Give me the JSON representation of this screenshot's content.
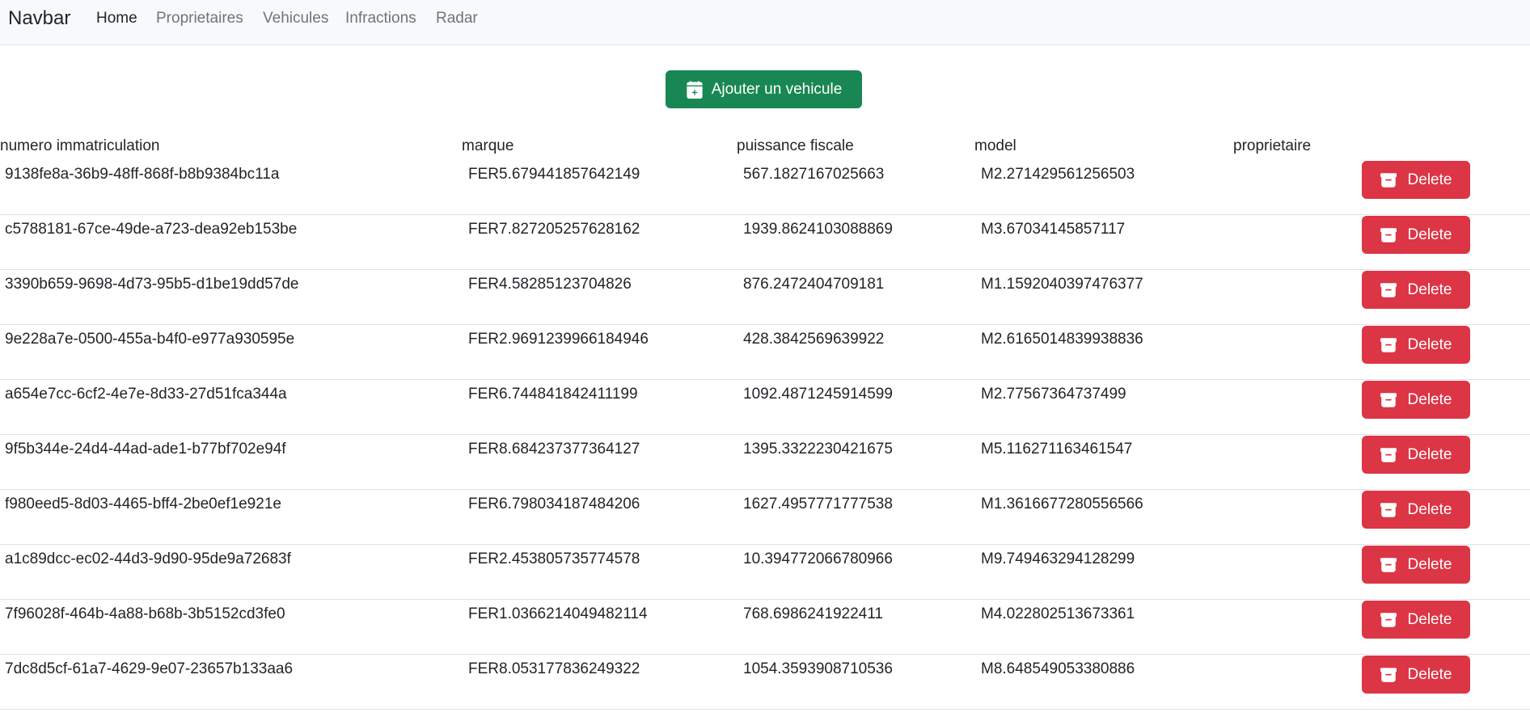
{
  "navbar": {
    "brand": "Navbar",
    "links": [
      {
        "label": "Home",
        "active": true
      },
      {
        "label": "Proprietaires",
        "active": false
      },
      {
        "label": "Vehicules",
        "active": false
      },
      {
        "label": "Infractions",
        "active": false
      },
      {
        "label": "Radar",
        "active": false
      }
    ]
  },
  "add_button": {
    "label": "Ajouter un vehicule",
    "icon": "calendar-plus-icon"
  },
  "table": {
    "headers": [
      "numero immatriculation",
      "marque",
      "puissance fiscale",
      "model",
      "proprietaire"
    ],
    "delete_label": "Delete",
    "delete_icon": "archive-icon",
    "rows": [
      {
        "immatriculation": "9138fe8a-36b9-48ff-868f-b8b9384bc11a",
        "marque": "FER5.679441857642149",
        "puissance": "567.1827167025663",
        "model": "M2.271429561256503",
        "proprietaire": ""
      },
      {
        "immatriculation": "c5788181-67ce-49de-a723-dea92eb153be",
        "marque": "FER7.827205257628162",
        "puissance": "1939.8624103088869",
        "model": "M3.67034145857117",
        "proprietaire": ""
      },
      {
        "immatriculation": "3390b659-9698-4d73-95b5-d1be19dd57de",
        "marque": "FER4.58285123704826",
        "puissance": "876.2472404709181",
        "model": "M1.1592040397476377",
        "proprietaire": ""
      },
      {
        "immatriculation": "9e228a7e-0500-455a-b4f0-e977a930595e",
        "marque": "FER2.9691239966184946",
        "puissance": "428.3842569639922",
        "model": "M2.6165014839938836",
        "proprietaire": ""
      },
      {
        "immatriculation": "a654e7cc-6cf2-4e7e-8d33-27d51fca344a",
        "marque": "FER6.744841842411199",
        "puissance": "1092.4871245914599",
        "model": "M2.77567364737499",
        "proprietaire": ""
      },
      {
        "immatriculation": "9f5b344e-24d4-44ad-ade1-b77bf702e94f",
        "marque": "FER8.684237377364127",
        "puissance": "1395.3322230421675",
        "model": "M5.116271163461547",
        "proprietaire": ""
      },
      {
        "immatriculation": "f980eed5-8d03-4465-bff4-2be0ef1e921e",
        "marque": "FER6.798034187484206",
        "puissance": "1627.4957771777538",
        "model": "M1.3616677280556566",
        "proprietaire": ""
      },
      {
        "immatriculation": "a1c89dcc-ec02-44d3-9d90-95de9a72683f",
        "marque": "FER2.453805735774578",
        "puissance": "10.394772066780966",
        "model": "M9.749463294128299",
        "proprietaire": ""
      },
      {
        "immatriculation": "7f96028f-464b-4a88-b68b-3b5152cd3fe0",
        "marque": "FER1.0366214049482114",
        "puissance": "768.6986241922411",
        "model": "M4.022802513673361",
        "proprietaire": ""
      },
      {
        "immatriculation": "7dc8d5cf-61a7-4629-9e07-23657b133aa6",
        "marque": "FER8.053177836249322",
        "puissance": "1054.3593908710536",
        "model": "M8.648549053380886",
        "proprietaire": ""
      }
    ]
  },
  "colors": {
    "success": "#198754",
    "danger": "#dc3545",
    "navbar_bg": "#f8f9fa",
    "muted": "#6c757d"
  }
}
